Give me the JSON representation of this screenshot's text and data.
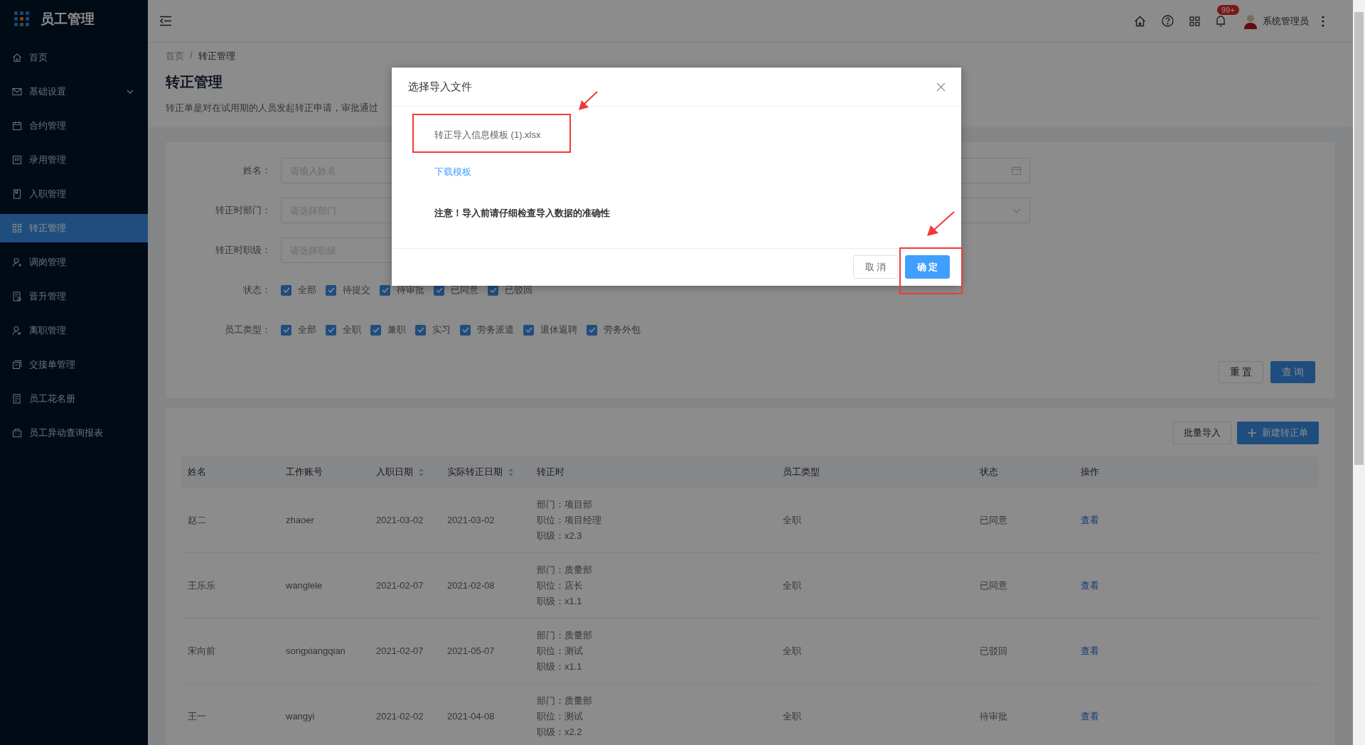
{
  "sidebar": {
    "title": "员工管理",
    "items": [
      {
        "label": "首页",
        "selected": false,
        "has_submenu": false
      },
      {
        "label": "基础设置",
        "selected": false,
        "has_submenu": true
      },
      {
        "label": "合约管理",
        "selected": false,
        "has_submenu": false
      },
      {
        "label": "录用管理",
        "selected": false,
        "has_submenu": false
      },
      {
        "label": "入职管理",
        "selected": false,
        "has_submenu": false
      },
      {
        "label": "转正管理",
        "selected": true,
        "has_submenu": false
      },
      {
        "label": "调岗管理",
        "selected": false,
        "has_submenu": false
      },
      {
        "label": "晋升管理",
        "selected": false,
        "has_submenu": false
      },
      {
        "label": "离职管理",
        "selected": false,
        "has_submenu": false
      },
      {
        "label": "交接单管理",
        "selected": false,
        "has_submenu": false
      },
      {
        "label": "员工花名册",
        "selected": false,
        "has_submenu": false
      },
      {
        "label": "员工异动查询报表",
        "selected": false,
        "has_submenu": false
      }
    ]
  },
  "header": {
    "badge": "99+",
    "user": "系统管理员"
  },
  "breadcrumb": {
    "items": [
      "首页",
      "转正管理"
    ],
    "separator": "/"
  },
  "page": {
    "title": "转正管理",
    "description": "转正单是对在试用期的人员发起转正申请，审批通过"
  },
  "filters": {
    "fields": [
      {
        "label": "姓名：",
        "placeholder": "请输入姓名"
      },
      {
        "label": "转正时部门：",
        "placeholder": "请选择部门"
      },
      {
        "label": "转正时职级：",
        "placeholder": "请选择职级"
      }
    ],
    "right_fields": [
      {
        "kind": "date"
      },
      {
        "kind": "select"
      }
    ],
    "checkbox_groups": [
      {
        "label": "状态：",
        "options": [
          {
            "label": "全部",
            "checked": true
          },
          {
            "label": "待提交",
            "checked": true
          },
          {
            "label": "待审批",
            "checked": true
          },
          {
            "label": "已同意",
            "checked": true
          },
          {
            "label": "已驳回",
            "checked": true
          }
        ]
      },
      {
        "label": "员工类型：",
        "options": [
          {
            "label": "全部",
            "checked": true
          },
          {
            "label": "全职",
            "checked": true
          },
          {
            "label": "兼职",
            "checked": true
          },
          {
            "label": "实习",
            "checked": true
          },
          {
            "label": "劳务派遣",
            "checked": true
          },
          {
            "label": "退休返聘",
            "checked": true
          },
          {
            "label": "劳务外包",
            "checked": true
          }
        ]
      }
    ],
    "buttons": [
      {
        "label": "重 置",
        "kind": "default"
      },
      {
        "label": "查 询",
        "kind": "primary"
      }
    ]
  },
  "table": {
    "actions": [
      {
        "label": "批量导入",
        "kind": "default"
      },
      {
        "label": "新建转正单",
        "kind": "primary"
      }
    ],
    "columns": [
      {
        "label": "姓名",
        "sortable": false
      },
      {
        "label": "工作账号",
        "sortable": false
      },
      {
        "label": "入职日期",
        "sortable": true
      },
      {
        "label": "实际转正日期",
        "sortable": true
      },
      {
        "label": "转正时",
        "sortable": false
      },
      {
        "label": "员工类型",
        "sortable": false
      },
      {
        "label": "状态",
        "sortable": false
      },
      {
        "label": "操作",
        "sortable": false
      }
    ],
    "rows": [
      {
        "name": "赵二",
        "account": "zhaoer",
        "hire_date": "2021-03-02",
        "regular_date": "2021-03-02",
        "details": [
          "部门：项目部",
          "职位：项目经理",
          "职级：x2.3"
        ],
        "type": "全职",
        "status": "已同意",
        "action": "查看"
      },
      {
        "name": "王乐乐",
        "account": "wanglele",
        "hire_date": "2021-02-07",
        "regular_date": "2021-02-08",
        "details": [
          "部门：质量部",
          "职位：店长",
          "职级：x1.1"
        ],
        "type": "全职",
        "status": "已同意",
        "action": "查看"
      },
      {
        "name": "宋向前",
        "account": "songxiangqian",
        "hire_date": "2021-02-07",
        "regular_date": "2021-05-07",
        "details": [
          "部门：质量部",
          "职位：测试",
          "职级：x1.1"
        ],
        "type": "全职",
        "status": "已驳回",
        "action": "查看"
      },
      {
        "name": "王一",
        "account": "wangyi",
        "hire_date": "2021-02-02",
        "regular_date": "2021-04-08",
        "details": [
          "部门：质量部",
          "职位：测试",
          "职级：x2.2"
        ],
        "type": "全职",
        "status": "待审批",
        "action": "查看"
      }
    ]
  },
  "dialog": {
    "title": "选择导入文件",
    "file": "转正导入信息模板 (1).xlsx",
    "link": "下载模板",
    "notice": "注意！导入前请仔细检查导入数据的准确性",
    "buttons": [
      {
        "label": "取 消",
        "kind": "default"
      },
      {
        "label": "确 定",
        "kind": "primary"
      }
    ]
  }
}
